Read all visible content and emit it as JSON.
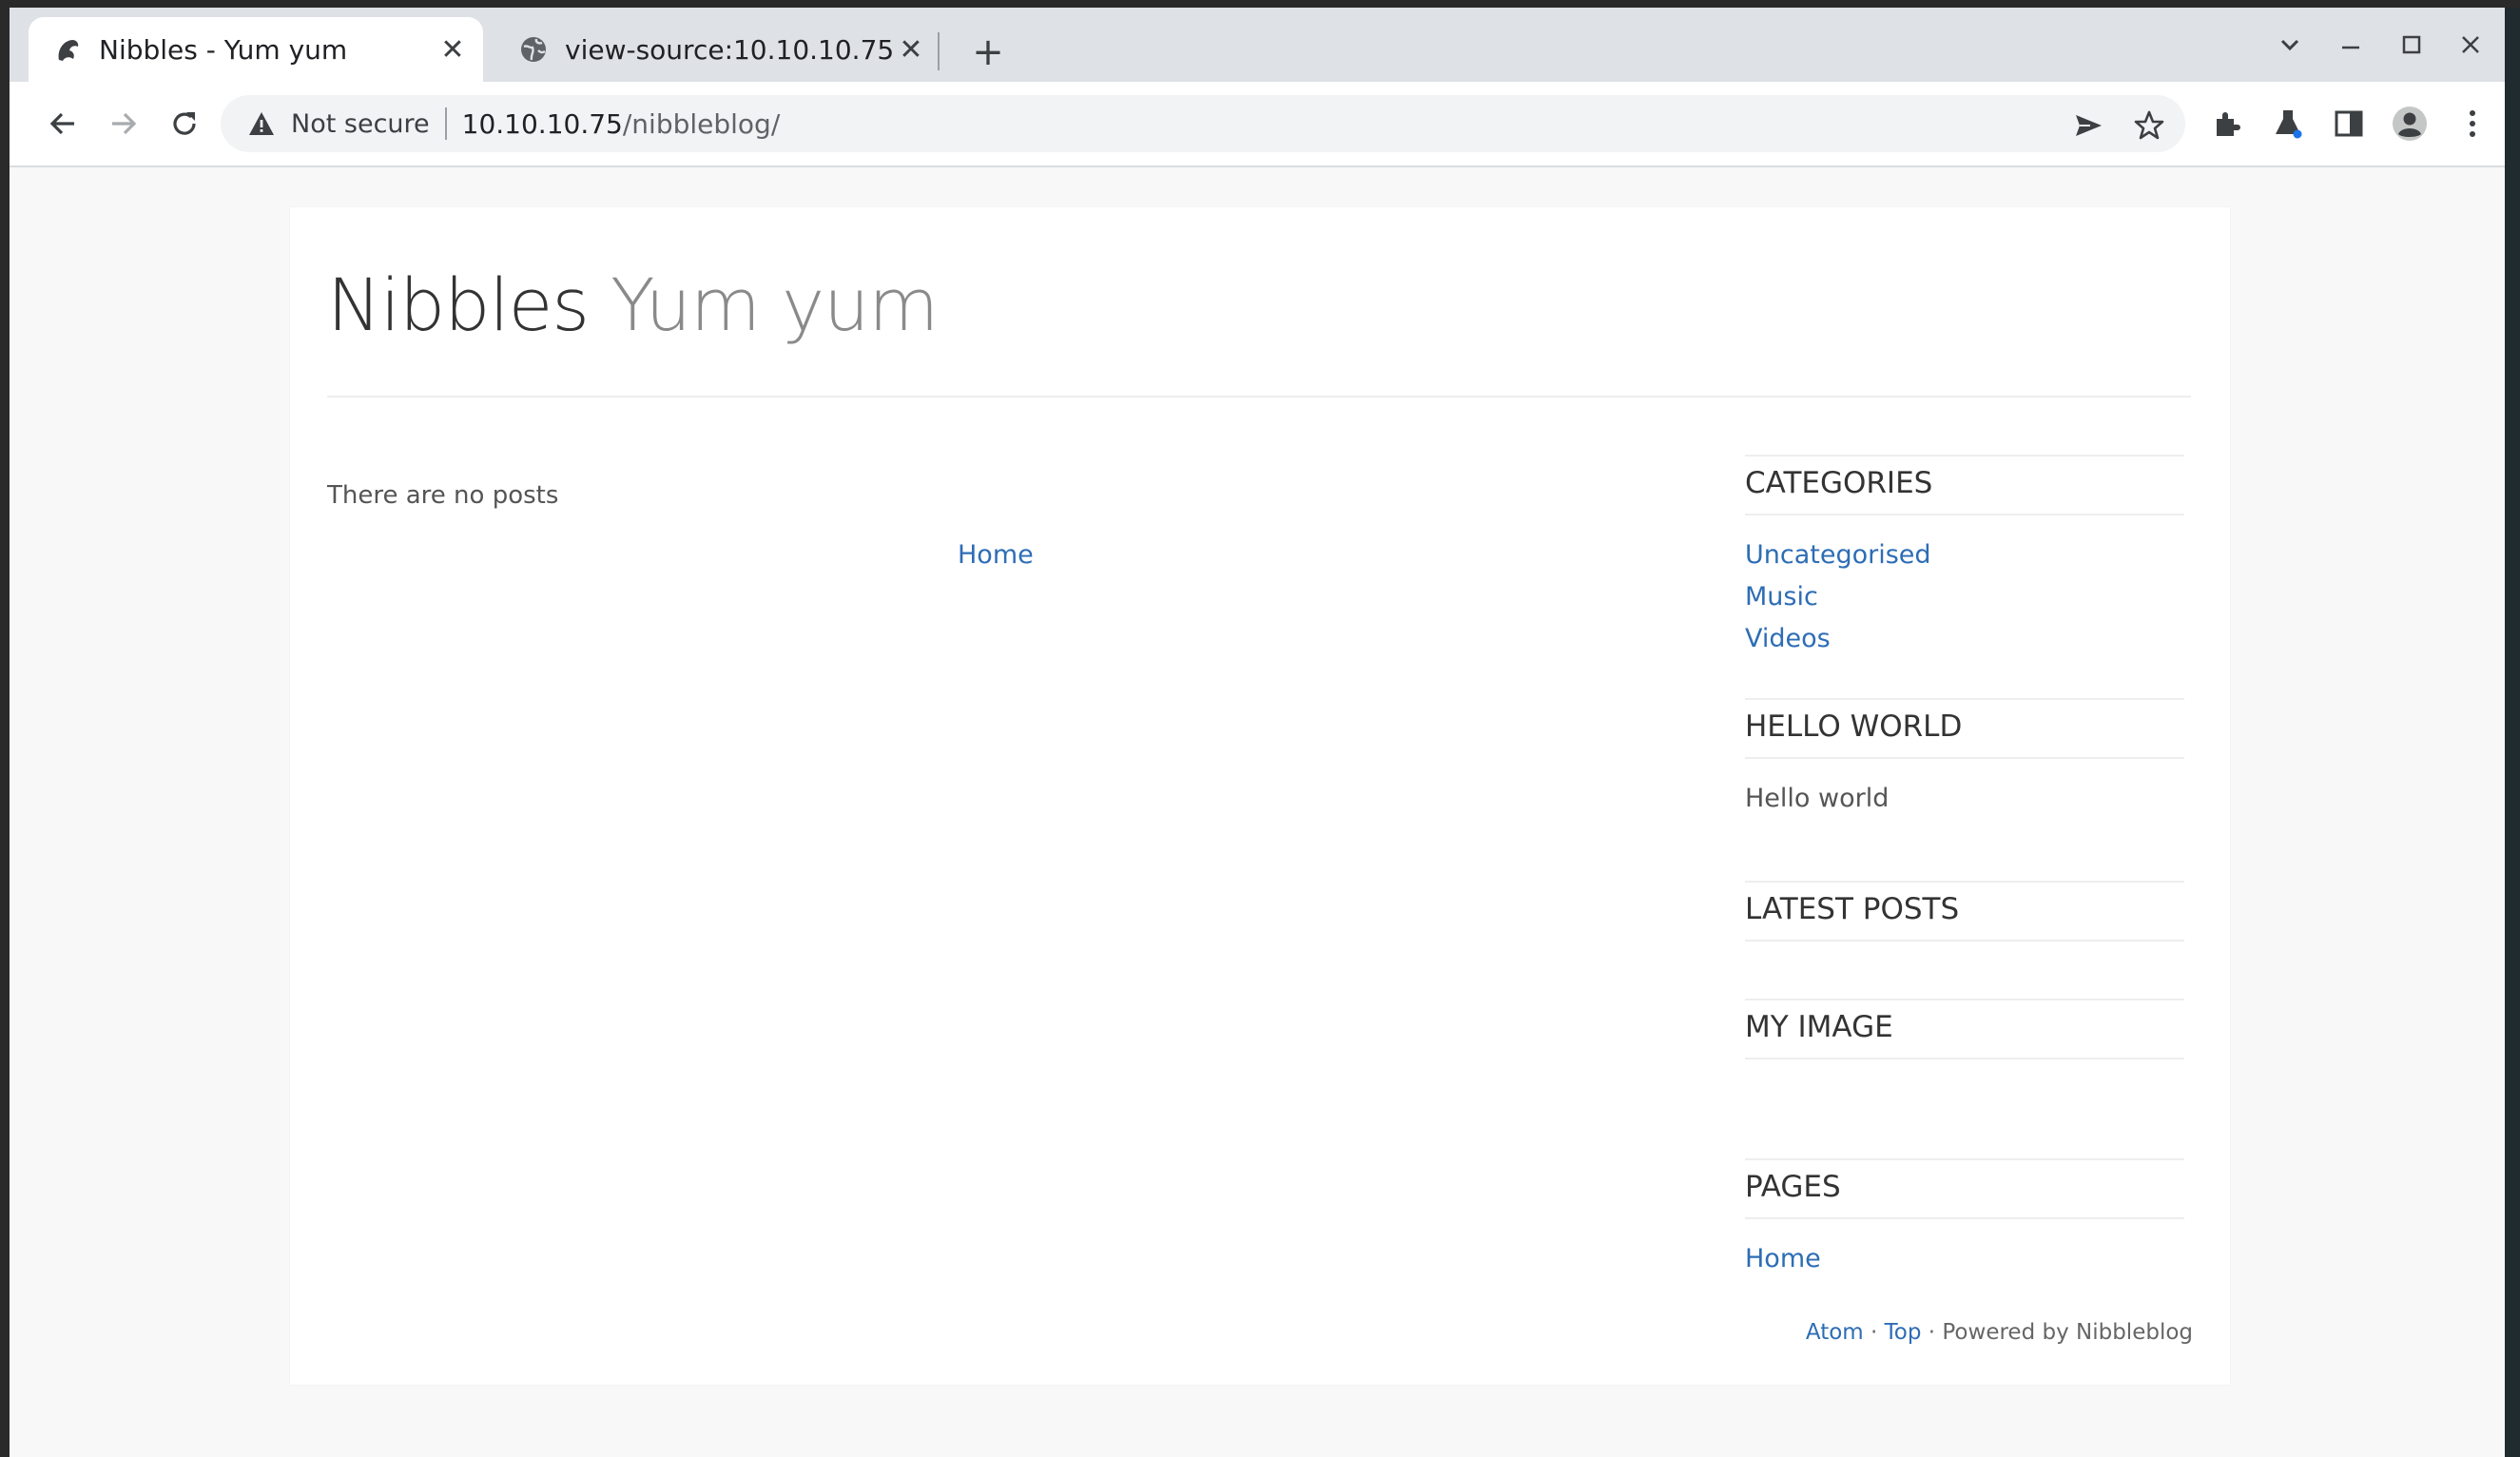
{
  "browser": {
    "tabs": [
      {
        "title": "Nibbles - Yum yum",
        "active": true,
        "favicon": "nibbleblog-favicon-icon"
      },
      {
        "title": "view-source:10.10.10.75",
        "active": false,
        "favicon": "globe-icon"
      }
    ],
    "address": {
      "security_label": "Not secure",
      "host": "10.10.10.75",
      "path": "/nibbleblog/"
    }
  },
  "blog": {
    "name": "Nibbles",
    "slogan": "Yum yum",
    "no_posts_text": "There are no posts",
    "home_link": "Home"
  },
  "sidebar": {
    "categories_title": "CATEGORIES",
    "categories": [
      "Uncategorised",
      "Music",
      "Videos"
    ],
    "hello_title": "HELLO WORLD",
    "hello_text": "Hello world",
    "latest_title": "LATEST POSTS",
    "image_title": "MY IMAGE",
    "pages_title": "PAGES",
    "pages": [
      "Home"
    ]
  },
  "footer": {
    "atom": "Atom",
    "sep1": " · ",
    "top": "Top",
    "powered": " · Powered by Nibbleblog"
  }
}
